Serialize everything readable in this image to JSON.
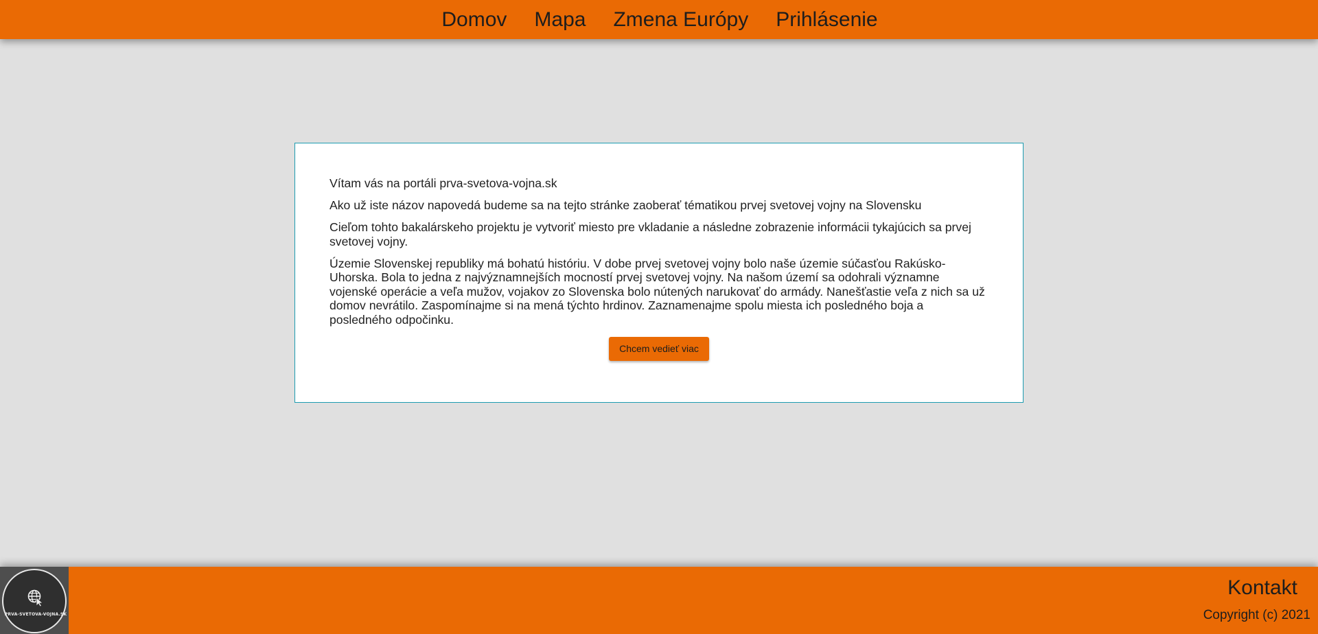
{
  "nav": {
    "items": [
      {
        "label": "Domov"
      },
      {
        "label": "Mapa"
      },
      {
        "label": "Zmena Európy"
      },
      {
        "label": "Prihlásenie"
      }
    ]
  },
  "card": {
    "paragraphs": [
      "Vítam vás na portáli prva-svetova-vojna.sk",
      "Ako už iste názov napovedá budeme sa na tejto stránke zaoberať tématikou prvej svetovej vojny na Slovensku",
      "Cieľom tohto bakalárskeho projektu je vytvoriť miesto pre vkladanie a následne zobrazenie informácii tykajúcich sa prvej svetovej vojny.",
      "Územie Slovenskej republiky má bohatú históriu. V dobe prvej svetovej vojny bolo naše územie súčasťou Rakúsko-Uhorska. Bola to jedna z najvýznamnejších mocností prvej svetovej vojny. Na našom území sa odohrali významne vojenské operácie a veľa mužov, vojakov zo Slovenska bolo nútených narukovať do armády. Nanešťastie veľa z nich sa už domov nevrátilo. Zaspomínajme si na mená týchto hrdinov. Zaznamenajme spolu miesta ich posledného boja a posledného odpočinku."
    ],
    "button_label": "Chcem vedieť viac"
  },
  "footer": {
    "logo_text": "PRVA-SVETOVA-VOJNA.SK",
    "logo_icon": "globe-cursor-icon",
    "kontakt": "Kontakt",
    "copyright": "Copyright (c) 2021"
  },
  "colors": {
    "accent": "#ea6a04",
    "background": "#e0e0e0",
    "card_border": "#1b9bb0",
    "logo_bg": "#4e4e4e"
  }
}
